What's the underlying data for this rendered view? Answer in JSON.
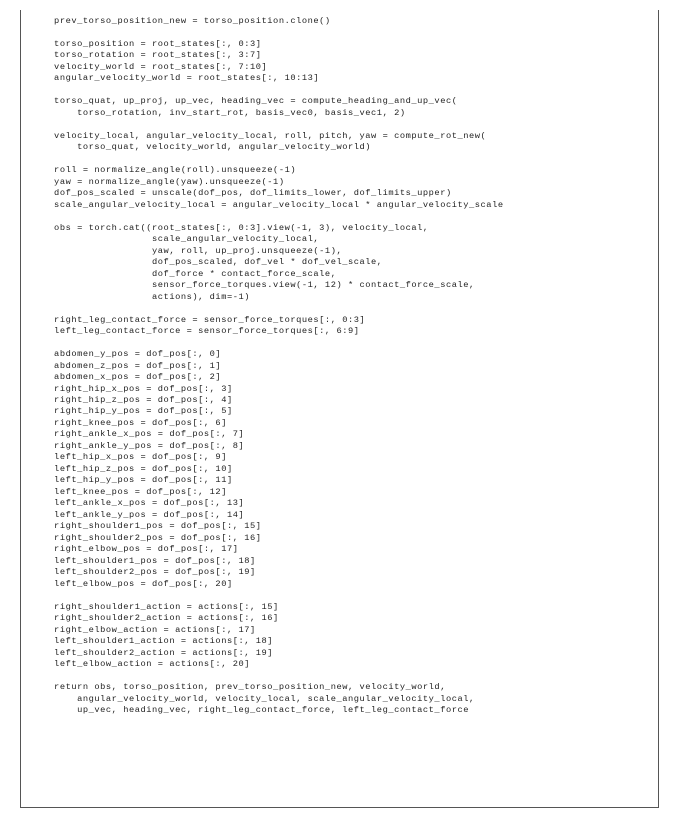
{
  "listing": {
    "indent_spaces": 4,
    "lines": [
      "prev_torso_position_new = torso_position.clone()",
      "",
      "torso_position = root_states[:, 0:3]",
      "torso_rotation = root_states[:, 3:7]",
      "velocity_world = root_states[:, 7:10]",
      "angular_velocity_world = root_states[:, 10:13]",
      "",
      "torso_quat, up_proj, up_vec, heading_vec = compute_heading_and_up_vec(",
      "    torso_rotation, inv_start_rot, basis_vec0, basis_vec1, 2)",
      "",
      "velocity_local, angular_velocity_local, roll, pitch, yaw = compute_rot_new(",
      "    torso_quat, velocity_world, angular_velocity_world)",
      "",
      "roll = normalize_angle(roll).unsqueeze(-1)",
      "yaw = normalize_angle(yaw).unsqueeze(-1)",
      "dof_pos_scaled = unscale(dof_pos, dof_limits_lower, dof_limits_upper)",
      "scale_angular_velocity_local = angular_velocity_local * angular_velocity_scale",
      "",
      "obs = torch.cat((root_states[:, 0:3].view(-1, 3), velocity_local,",
      "                 scale_angular_velocity_local,",
      "                 yaw, roll, up_proj.unsqueeze(-1),",
      "                 dof_pos_scaled, dof_vel * dof_vel_scale,",
      "                 dof_force * contact_force_scale,",
      "                 sensor_force_torques.view(-1, 12) * contact_force_scale,",
      "                 actions), dim=-1)",
      "",
      "right_leg_contact_force = sensor_force_torques[:, 0:3]",
      "left_leg_contact_force = sensor_force_torques[:, 6:9]",
      "",
      "abdomen_y_pos = dof_pos[:, 0]",
      "abdomen_z_pos = dof_pos[:, 1]",
      "abdomen_x_pos = dof_pos[:, 2]",
      "right_hip_x_pos = dof_pos[:, 3]",
      "right_hip_z_pos = dof_pos[:, 4]",
      "right_hip_y_pos = dof_pos[:, 5]",
      "right_knee_pos = dof_pos[:, 6]",
      "right_ankle_x_pos = dof_pos[:, 7]",
      "right_ankle_y_pos = dof_pos[:, 8]",
      "left_hip_x_pos = dof_pos[:, 9]",
      "left_hip_z_pos = dof_pos[:, 10]",
      "left_hip_y_pos = dof_pos[:, 11]",
      "left_knee_pos = dof_pos[:, 12]",
      "left_ankle_x_pos = dof_pos[:, 13]",
      "left_ankle_y_pos = dof_pos[:, 14]",
      "right_shoulder1_pos = dof_pos[:, 15]",
      "right_shoulder2_pos = dof_pos[:, 16]",
      "right_elbow_pos = dof_pos[:, 17]",
      "left_shoulder1_pos = dof_pos[:, 18]",
      "left_shoulder2_pos = dof_pos[:, 19]",
      "left_elbow_pos = dof_pos[:, 20]",
      "",
      "right_shoulder1_action = actions[:, 15]",
      "right_shoulder2_action = actions[:, 16]",
      "right_elbow_action = actions[:, 17]",
      "left_shoulder1_action = actions[:, 18]",
      "left_shoulder2_action = actions[:, 19]",
      "left_elbow_action = actions[:, 20]",
      "",
      "return obs, torso_position, prev_torso_position_new, velocity_world,",
      "    angular_velocity_world, velocity_local, scale_angular_velocity_local,",
      "    up_vec, heading_vec, right_leg_contact_force, left_leg_contact_force"
    ]
  }
}
